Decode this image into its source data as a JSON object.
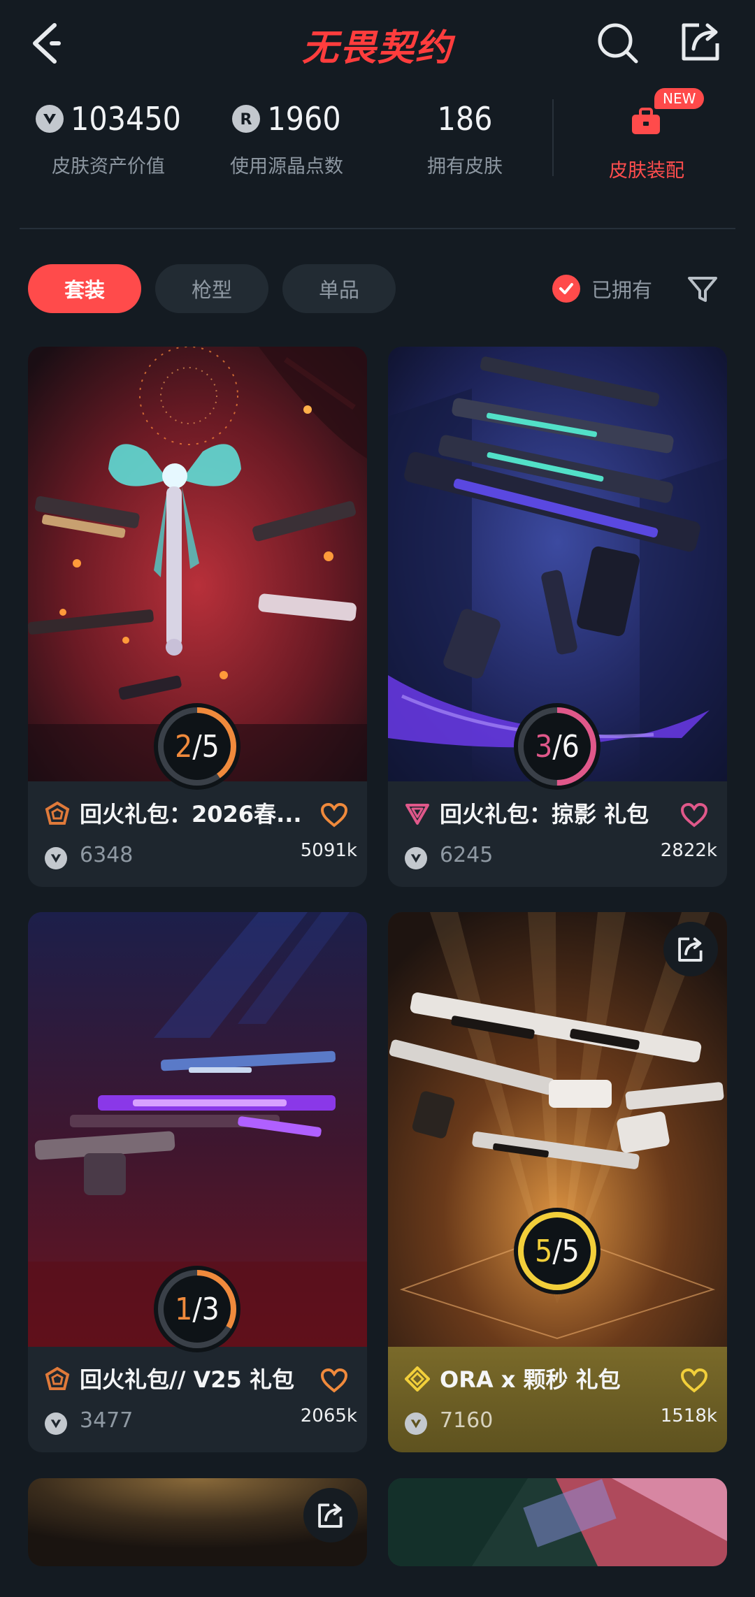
{
  "header": {
    "logo_text": "无畏契约",
    "back_icon": "chevron-left-icon",
    "search_icon": "search-icon",
    "share_icon": "share-icon"
  },
  "stats": [
    {
      "value": "103450",
      "label": "皮肤资产价值",
      "icon": "vp-coin-icon"
    },
    {
      "value": "1960",
      "label": "使用源晶点数",
      "icon": "radianite-icon"
    },
    {
      "value": "186",
      "label": "拥有皮肤",
      "icon": ""
    }
  ],
  "equip": {
    "label": "皮肤装配",
    "badge": "NEW",
    "icon": "briefcase-icon"
  },
  "filters": {
    "chips": [
      {
        "label": "套装",
        "active": true
      },
      {
        "label": "枪型",
        "active": false
      },
      {
        "label": "单品",
        "active": false
      }
    ],
    "owned_label": "已拥有",
    "owned_checked": true,
    "filter_icon": "filter-icon"
  },
  "colors": {
    "accent": "#ff4b4b",
    "background": "#141b22",
    "card": "#1e262e",
    "gold": "#f2cf3a"
  },
  "cards": [
    {
      "title": "回火礼包：2026春...",
      "price": "6348",
      "likes": "5091k",
      "owned": 2,
      "total": 5,
      "progress_text_a": "2",
      "progress_text_b": "5",
      "tier": "premium",
      "ring_color": "#f08a3c",
      "heart_color": "#f08a3c",
      "tier_color": "#e07a3a"
    },
    {
      "title": "回火礼包：掠影 礼包",
      "price": "6245",
      "likes": "2822k",
      "owned": 3,
      "total": 6,
      "progress_text_a": "3",
      "progress_text_b": "6",
      "tier": "exclusive",
      "ring_color": "#e0588a",
      "heart_color": "#e0588a",
      "tier_color": "#e0588a"
    },
    {
      "title": "回火礼包// V25 礼包",
      "price": "3477",
      "likes": "2065k",
      "owned": 1,
      "total": 3,
      "progress_text_a": "1",
      "progress_text_b": "3",
      "tier": "premium",
      "ring_color": "#f08a3c",
      "heart_color": "#f08a3c",
      "tier_color": "#e07a3a"
    },
    {
      "title": "ORA x 颗秒 礼包",
      "price": "7160",
      "likes": "1518k",
      "owned": 5,
      "total": 5,
      "progress_text_a": "5",
      "progress_text_b": "5",
      "tier": "ultra",
      "ring_color": "#f2cf3a",
      "heart_color": "#f2cf3a",
      "tier_color": "#f2cf3a"
    }
  ]
}
